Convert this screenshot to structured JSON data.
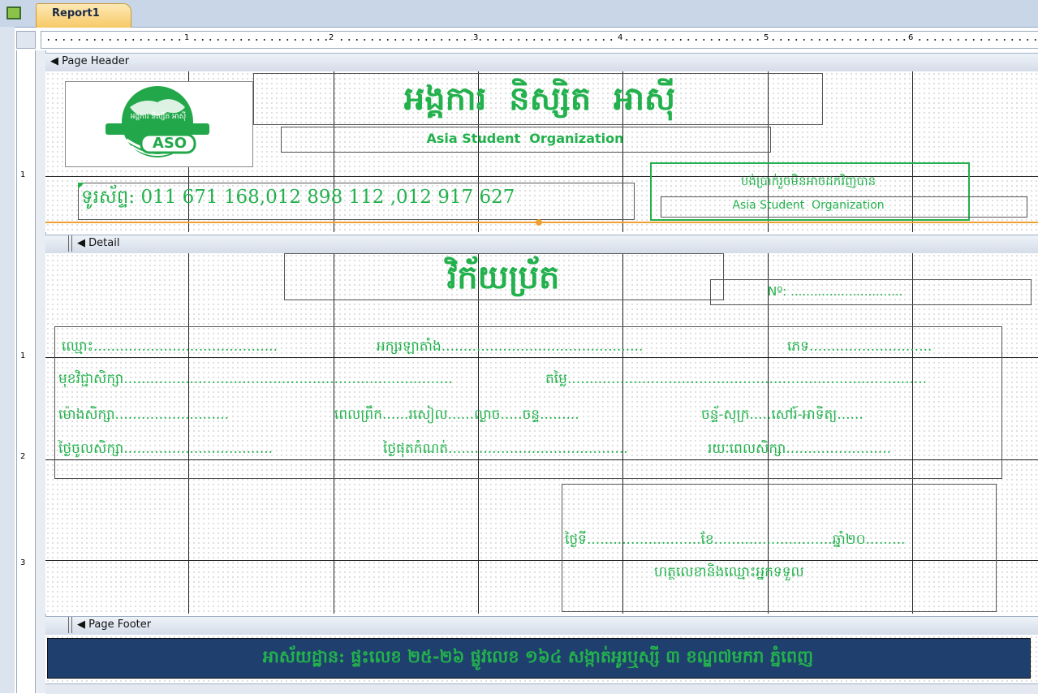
{
  "tab": {
    "label": "Report1"
  },
  "ruler": {
    "h_numbers": [
      "1",
      "2",
      "3",
      "4",
      "5",
      "6"
    ],
    "v_numbers_header": [
      "1"
    ],
    "v_numbers_detail": [
      "1",
      "2",
      "3"
    ]
  },
  "sections": {
    "page_header": "Page Header",
    "detail": "Detail",
    "page_footer": "Page Footer"
  },
  "header": {
    "logo_caption": "ASO",
    "logo_khmer": "អង្គការ និស្សិត អាស៊ី",
    "title_khmer": "អង្គការ  និស្សិត  អាស៊ី",
    "title_english": "Asia Student  Organization",
    "phone": "ទូរស័ព្ទ: 011 671 168,012 898 112 ,012 917 627",
    "stamp_khmer": "បង់ប្រាក់រួចមិនអាចដកវិញបាន",
    "stamp_english": "Asia Student  Organization"
  },
  "detail": {
    "title": "វិក័យប្រ័ត",
    "number_label": "Nº: .............................",
    "row1": [
      "ឈ្មោះ..........................................",
      "អក្សរឡាតាំង..............................................",
      "ភេទ............................"
    ],
    "row2": [
      "មុខវិជ្ជាសិក្សា...........................................................................",
      "តម្លៃ.................................................................................."
    ],
    "row3": [
      "ម៉ោងសិក្សា..........................",
      "ពេលព្រឹក......រសៀល......ល្ងាច.....ចន្ទ.........",
      "ចន្ទ័-សុក្រ.....សៅរ៍-អាទិត្យ......"
    ],
    "row4": [
      "ថ្ងៃចូលសិក្សា..................................",
      "ថ្ងៃផុតកំណត់.........................................",
      "រយៈពេលសិក្សា........................"
    ],
    "date_line": "ថ្ងៃទី..........................ខែ...........................ឆ្នាំ២០.........",
    "signature": "ហត្ថលេខានិងឈ្មោះអ្នកទទួល"
  },
  "footer": {
    "address": "អាស័យដ្ឋាន: ផ្ទះលេខ ២៥-២៦ ផ្លូវលេខ ១៦៤ សង្កាត់អូរឬស្សី ៣ ខណ្ឌ៧មករា ភ្នំពេញ"
  },
  "colors": {
    "green": "#22b14c",
    "footer_bg": "#1f3f6e",
    "footer_text": "#22b14c",
    "divider": "#f0a030"
  }
}
